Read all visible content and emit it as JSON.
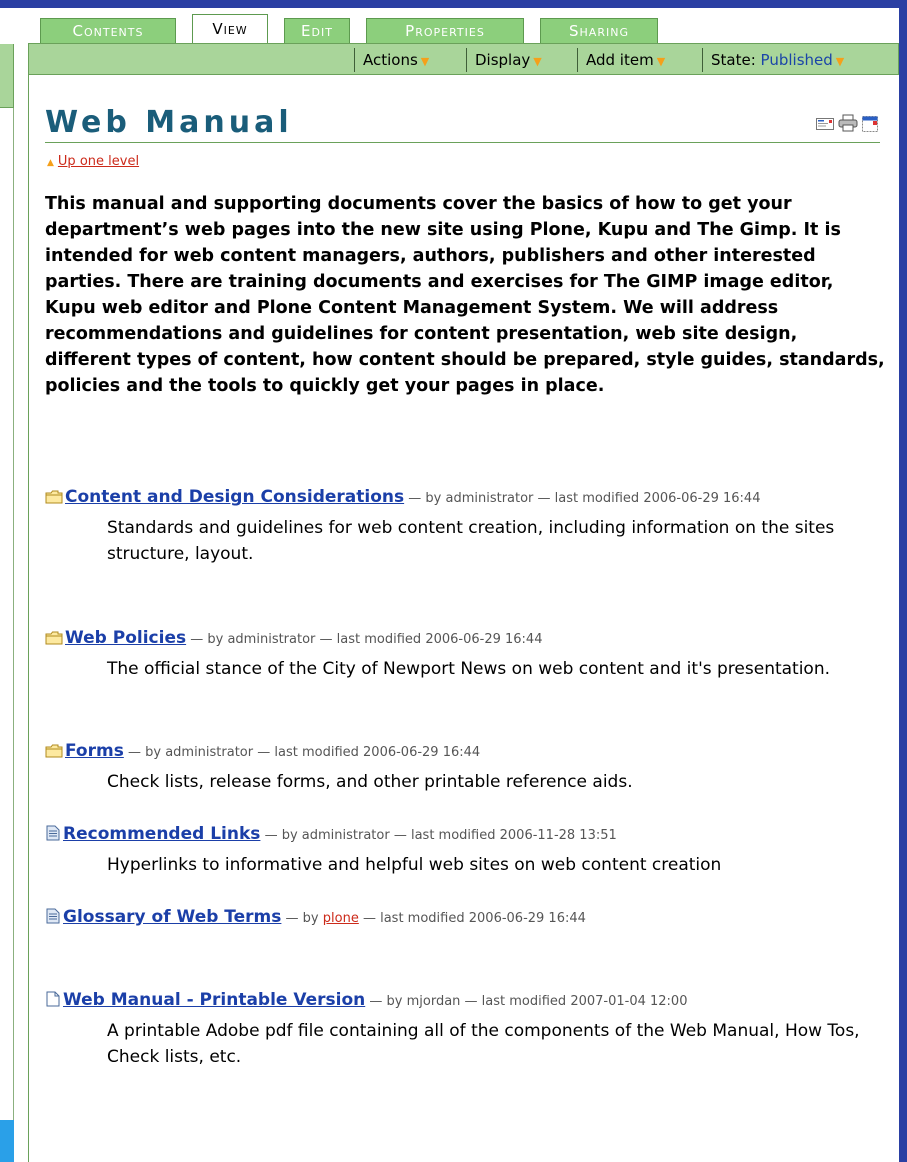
{
  "tabs": [
    {
      "label": "Contents",
      "active": false
    },
    {
      "label": "View",
      "active": true
    },
    {
      "label": "Edit",
      "active": false
    },
    {
      "label": "Properties",
      "active": false
    },
    {
      "label": "Sharing",
      "active": false
    }
  ],
  "actionbar": {
    "actions": "Actions",
    "display": "Display",
    "add_item": "Add item",
    "state_label": "State:",
    "state_value": "Published"
  },
  "page": {
    "title": "Web Manual",
    "up_one_level": "Up one level",
    "description": "This manual and supporting documents cover the basics of how to get your department’s web pages into the new site using Plone, Kupu and The Gimp. It is intended for web content managers, authors, publishers and other interested parties. There are training documents and exercises for The GIMP image editor, Kupu web editor and Plone Content Management System. We will address recommendations and guidelines for content presentation, web site design, different types of content, how content should be prepared, style guides, standards, policies and the tools to quickly get your pages in place."
  },
  "doc_icons": [
    "email-icon",
    "print-icon",
    "fullscreen-icon"
  ],
  "items": [
    {
      "icon": "folder-icon",
      "title": "Content and Design Considerations",
      "by": "administrator",
      "modified": "2006-06-29 16:44",
      "description": "Standards and guidelines for web content creation, including information on the sites structure, layout."
    },
    {
      "icon": "folder-icon",
      "title": "Web Policies",
      "by": "administrator",
      "modified": "2006-06-29 16:44",
      "description": "The official stance of the City of Newport News on web content and it's presentation."
    },
    {
      "icon": "folder-icon",
      "title": "Forms",
      "by": "administrator",
      "modified": "2006-06-29 16:44",
      "description": "Check lists, release forms, and other printable reference aids."
    },
    {
      "icon": "document-icon",
      "title": "Recommended Links",
      "by": "administrator",
      "modified": "2006-11-28 13:51",
      "description": "Hyperlinks to informative and helpful web sites on web content creation"
    },
    {
      "icon": "document-icon",
      "title": "Glossary of Web Terms",
      "by": "plone",
      "modified": "2006-06-29 16:44",
      "description": ""
    },
    {
      "icon": "file-icon",
      "title": "Web Manual - Printable Version",
      "by": "mjordan",
      "modified": "2007-01-04 12:00",
      "description": "A printable Adobe pdf file containing all of the components of the Web Manual, How Tos, Check lists, etc."
    }
  ],
  "labels": {
    "by_prefix": "— by",
    "modified_prefix": "— last modified"
  },
  "colors": {
    "tab_green": "#8ccf7c",
    "bar_green": "#a9d59a",
    "link_blue": "#1b3fa8",
    "title_teal": "#1a5d7a",
    "accent_red": "#cc2a1a",
    "frame_blue": "#2a3fa3"
  }
}
